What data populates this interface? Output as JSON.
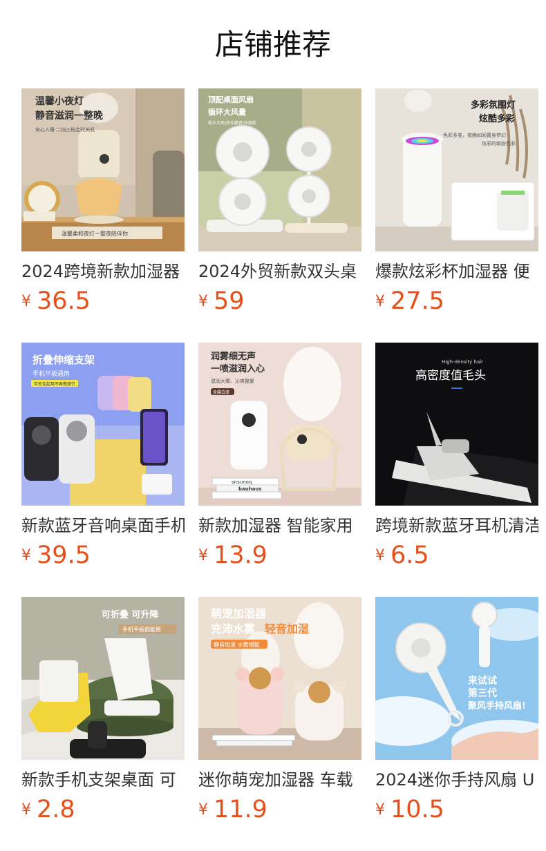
{
  "section": {
    "title": "店铺推荐"
  },
  "products": [
    {
      "name": "2024跨境新款加湿器",
      "currency": "¥",
      "price": "36.5",
      "image_icon": "night-light-humidifier-image",
      "image_text": [
        "温馨小夜灯",
        "静音滋润一整晚",
        "安心入睡 二挡三档定时关机",
        "温馨柔和夜灯一整夜陪伴你"
      ]
    },
    {
      "name": "2024外贸新款双头桌",
      "currency": "¥",
      "price": "59",
      "image_icon": "dual-head-desk-fan-image",
      "image_text": [
        "顶配桌面风扇",
        "循环大风量",
        "摇头大风|安全静音|长续航"
      ]
    },
    {
      "name": "爆款炫彩杯加湿器 便",
      "currency": "¥",
      "price": "27.5",
      "image_icon": "colorful-cup-humidifier-image",
      "image_text": [
        "多彩氛围灯",
        "炫酷多彩",
        "色彩多变，夜晚如同置身梦幻",
        "炫彩的缤纷色彩"
      ]
    },
    {
      "name": "新款蓝牙音响桌面手机",
      "currency": "¥",
      "price": "39.5",
      "image_icon": "bluetooth-speaker-stand-image",
      "image_text": [
        "折叠伸缩支架",
        "手机平板通用",
        "可去走起用不再做旅行"
      ]
    },
    {
      "name": "新款加湿器 智能家用",
      "currency": "¥",
      "price": "13.9",
      "image_icon": "smart-home-humidifier-image",
      "image_text": [
        "润雾细无声",
        "一喷滋润入心",
        "滋润大雾、沁爽整夏",
        "金属白漆",
        "bauhaus",
        "snsunoq"
      ]
    },
    {
      "name": "跨境新款蓝牙耳机清洁",
      "currency": "¥",
      "price": "6.5",
      "image_icon": "earbud-cleaning-pen-image",
      "image_text": [
        "High-density hair",
        "高密度值毛头"
      ]
    },
    {
      "name": "新款手机支架桌面 可",
      "currency": "¥",
      "price": "2.8",
      "image_icon": "foldable-phone-stand-image",
      "image_text": [
        "可折叠 可升降",
        "手机平板都能用"
      ]
    },
    {
      "name": "迷你萌宠加湿器 车载",
      "currency": "¥",
      "price": "11.9",
      "image_icon": "mini-pet-humidifier-image",
      "image_text": [
        "萌宠加湿器",
        "充沛水雾",
        "轻音加湿",
        "静音加湿 水雾细腻"
      ]
    },
    {
      "name": "2024迷你手持风扇 U",
      "currency": "¥",
      "price": "10.5",
      "image_icon": "handheld-fan-image",
      "image_text": [
        "来试试",
        "第三代",
        "聚风手持风扇!"
      ]
    }
  ],
  "colors": {
    "price": "#e4501b",
    "text": "#333333",
    "title": "#111111"
  }
}
